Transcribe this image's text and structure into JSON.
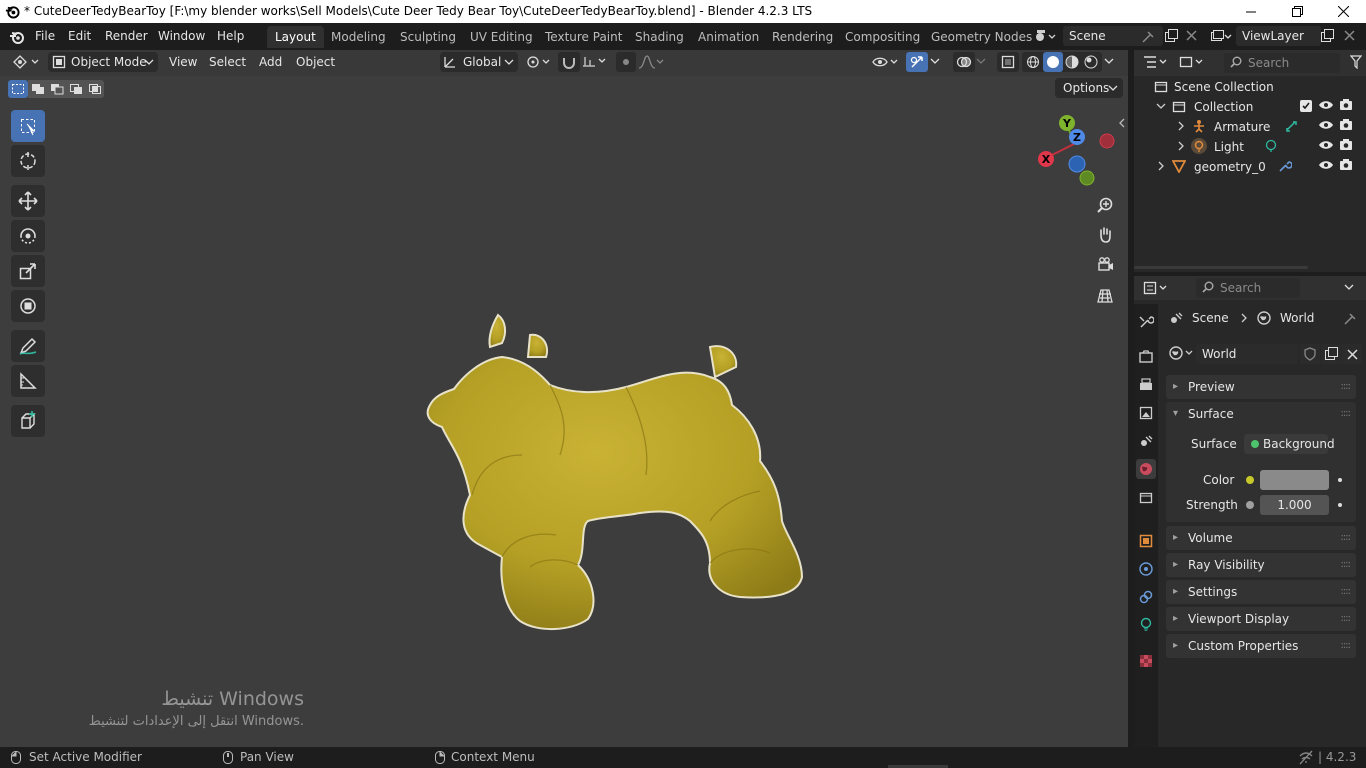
{
  "window": {
    "title": "* CuteDeerTedyBearToy [F:\\my blender works\\Sell Models\\Cute Deer Tedy Bear Toy\\CuteDeerTedyBearToy.blend] - Blender 4.2.3 LTS"
  },
  "menu": [
    "File",
    "Edit",
    "Render",
    "Window",
    "Help"
  ],
  "workspaces": [
    "Layout",
    "Modeling",
    "Sculpting",
    "UV Editing",
    "Texture Paint",
    "Shading",
    "Animation",
    "Rendering",
    "Compositing",
    "Geometry Nodes"
  ],
  "active_workspace": "Layout",
  "scene": "Scene",
  "view_layer": "ViewLayer",
  "viewport": {
    "mode": "Object Mode",
    "menus": [
      "View",
      "Select",
      "Add",
      "Object"
    ],
    "transform_orientation": "Global",
    "options_label": "Options",
    "gizmo": {
      "x": "X",
      "y": "Y",
      "z": "Z"
    },
    "model_color": "#b5a025",
    "watermark": {
      "title": "تنشيط Windows",
      "subtitle": "انتقل إلى الإعدادات لتنشيط Windows."
    }
  },
  "outliner": {
    "search_placeholder": "Search",
    "root": "Scene Collection",
    "items": [
      {
        "name": "Collection"
      },
      {
        "name": "Armature"
      },
      {
        "name": "Light"
      },
      {
        "name": "geometry_0"
      }
    ]
  },
  "properties": {
    "search_placeholder": "Search",
    "breadcrumb": [
      "Scene",
      "World"
    ],
    "world_name": "World",
    "panels": {
      "preview": "Preview",
      "surface": "Surface",
      "volume": "Volume",
      "ray_visibility": "Ray Visibility",
      "settings": "Settings",
      "viewport_display": "Viewport Display",
      "custom_properties": "Custom Properties"
    },
    "surface": {
      "surface_label": "Surface",
      "surface_value": "Background",
      "color_label": "Color",
      "strength_label": "Strength",
      "strength_value": "1.000"
    }
  },
  "statusbar": {
    "left": "Set Active Modifier",
    "middle": "Pan View",
    "right": "Context Menu",
    "version": "4.2.3"
  },
  "colors": {
    "accent": "#4772b3",
    "viewport_bg": "#3d3d3d",
    "panel_bg": "#282828"
  }
}
